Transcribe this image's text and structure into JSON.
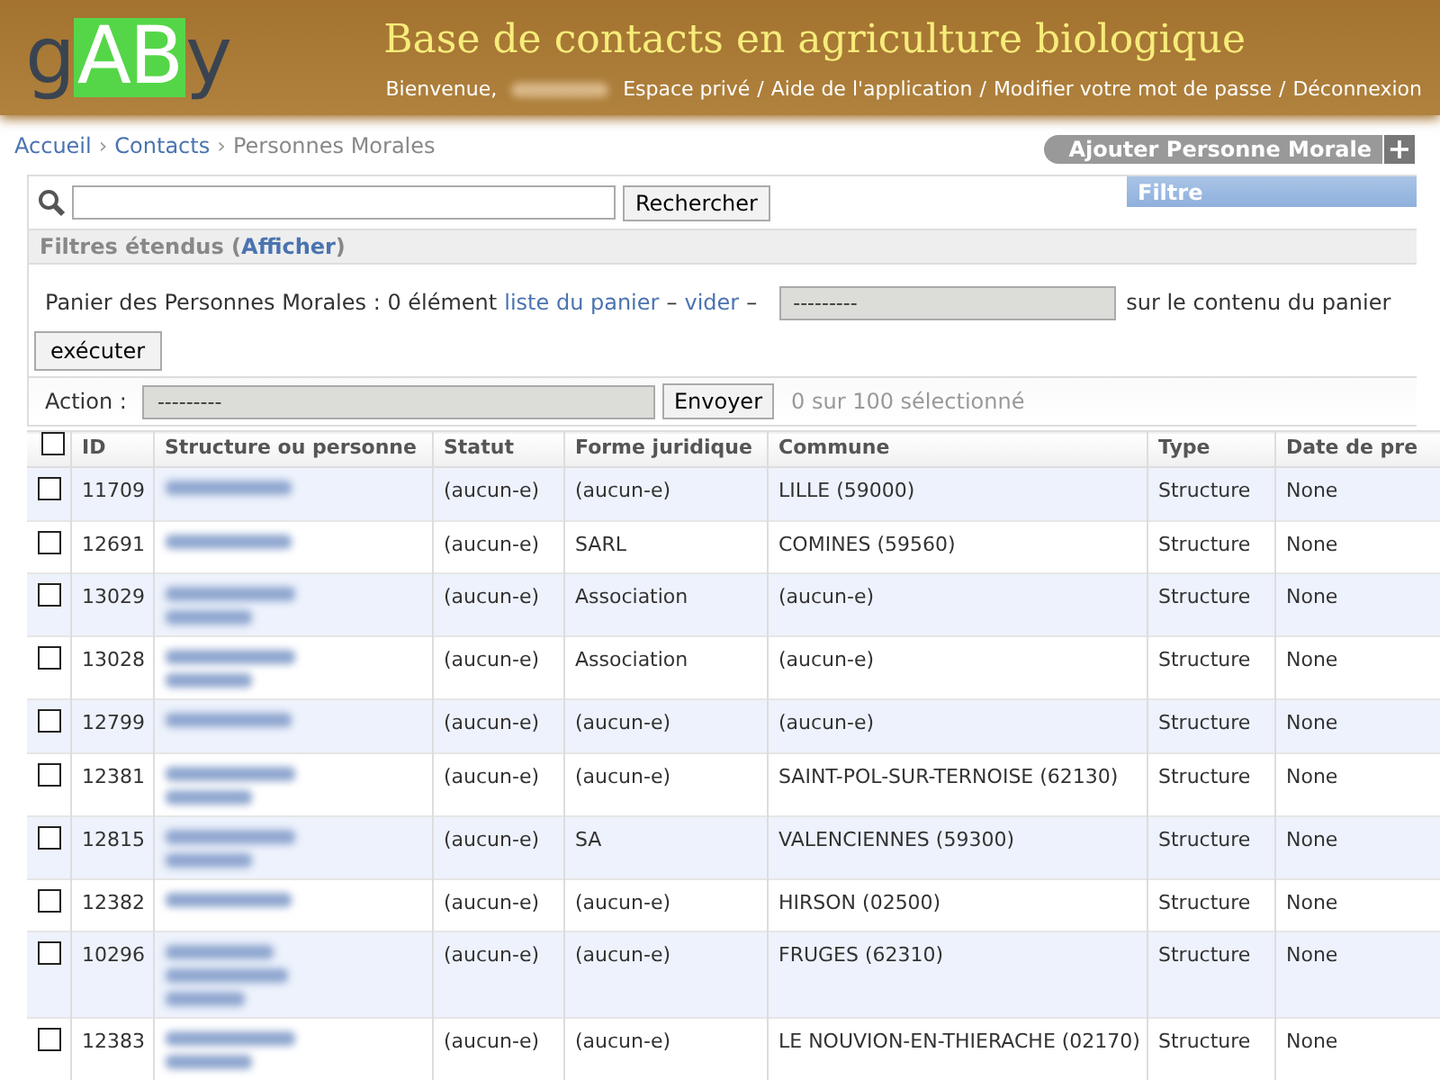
{
  "header": {
    "logo": [
      "g",
      "AB",
      "y"
    ],
    "title": "Base de contacts en agriculture biologique",
    "welcome": "Bienvenue,",
    "links": [
      {
        "label": "Espace privé"
      },
      {
        "label": "Aide de l'application"
      },
      {
        "label": "Modifier votre mot de passe"
      },
      {
        "label": "Déconnexion"
      }
    ],
    "separator": "/"
  },
  "breadcrumb": [
    {
      "label": "Accueil",
      "link": true
    },
    {
      "label": "Contacts",
      "link": true
    },
    {
      "label": "Personnes Morales",
      "link": false
    }
  ],
  "breadcrumb_separator": "›",
  "add_button": {
    "label": "Ajouter Personne Morale",
    "icon": "+"
  },
  "search": {
    "button": "Rechercher"
  },
  "filter_panel": {
    "title": "Filtre"
  },
  "extended_filters": {
    "label": "Filtres étendus (",
    "link": "Afficher",
    "suffix": ")"
  },
  "basket": {
    "text": "Panier des Personnes Morales : 0 élément",
    "list_link": "liste du panier",
    "dash1": "–",
    "clear_link": "vider",
    "dash2": "–",
    "select": "---------",
    "suffix": "sur le contenu du panier",
    "button": "exécuter"
  },
  "action": {
    "label": "Action :",
    "select": "---------",
    "button": "Envoyer",
    "count": "0 sur 100 sélectionné"
  },
  "table": {
    "columns": [
      "ID",
      "Structure ou personne",
      "Statut",
      "Forme juridique",
      "Commune",
      "Type",
      "Date de pre"
    ],
    "select_all_checked": false,
    "rows": [
      {
        "checked": false,
        "id": "11709",
        "kind": "short",
        "statut": "(aucun-e)",
        "forme": "(aucun-e)",
        "commune": "LILLE (59000)",
        "type": "Structure",
        "date": "None"
      },
      {
        "checked": false,
        "id": "12691",
        "kind": "short",
        "statut": "(aucun-e)",
        "forme": "SARL",
        "commune": "COMINES (59560)",
        "type": "Structure",
        "date": "None"
      },
      {
        "checked": false,
        "id": "13029",
        "kind": "long",
        "statut": "(aucun-e)",
        "forme": "Association",
        "commune": "(aucun-e)",
        "type": "Structure",
        "date": "None"
      },
      {
        "checked": false,
        "id": "13028",
        "kind": "long",
        "statut": "(aucun-e)",
        "forme": "Association",
        "commune": "(aucun-e)",
        "type": "Structure",
        "date": "None"
      },
      {
        "checked": false,
        "id": "12799",
        "kind": "short",
        "statut": "(aucun-e)",
        "forme": "(aucun-e)",
        "commune": "(aucun-e)",
        "type": "Structure",
        "date": "None"
      },
      {
        "checked": false,
        "id": "12381",
        "kind": "long",
        "statut": "(aucun-e)",
        "forme": "(aucun-e)",
        "commune": "SAINT-POL-SUR-TERNOISE (62130)",
        "type": "Structure",
        "date": "None"
      },
      {
        "checked": false,
        "id": "12815",
        "kind": "long",
        "statut": "(aucun-e)",
        "forme": "SA",
        "commune": "VALENCIENNES (59300)",
        "type": "Structure",
        "date": "None"
      },
      {
        "checked": false,
        "id": "12382",
        "kind": "short",
        "statut": "(aucun-e)",
        "forme": "(aucun-e)",
        "commune": "HIRSON (02500)",
        "type": "Structure",
        "date": "None"
      },
      {
        "checked": false,
        "id": "10296",
        "kind": "longer",
        "statut": "(aucun-e)",
        "forme": "(aucun-e)",
        "commune": "FRUGES (62310)",
        "type": "Structure",
        "date": "None"
      },
      {
        "checked": false,
        "id": "12383",
        "kind": "long",
        "statut": "(aucun-e)",
        "forme": "(aucun-e)",
        "commune": "LE NOUVION-EN-THIERACHE (02170)",
        "type": "Structure",
        "date": "None"
      }
    ]
  }
}
